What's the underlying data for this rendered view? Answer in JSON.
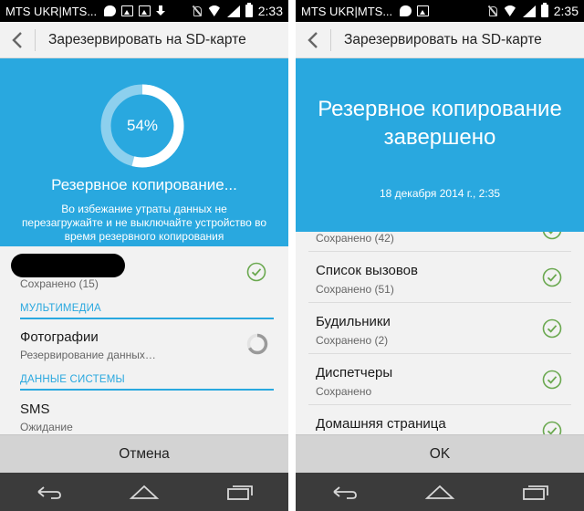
{
  "left": {
    "status_bar": {
      "carrier": "MTS UKR|MTS...",
      "time": "2:33",
      "icons": [
        "hangouts-icon",
        "image-icon",
        "image-icon",
        "download-icon",
        "mute-icon",
        "wifi-icon",
        "signal-icon",
        "battery-icon"
      ]
    },
    "title": "Зарезервировать на SD-карте",
    "progress_value": 0.54,
    "progress_text": "54%",
    "status_text": "Резервное копирование...",
    "warning_text": "Во избежание утраты данных не перезагружайте и не выключайте устройство во время резервного копирования",
    "items": [
      {
        "subtitle": "Сохранено (15)",
        "status": "check-icon"
      }
    ],
    "section_media": "МУЛЬТИМЕДИА",
    "media_items": [
      {
        "title": "Фотографии",
        "subtitle": "Резервирование данных…",
        "status": "spinner-icon"
      }
    ],
    "section_system": "ДАННЫЕ СИСТЕМЫ",
    "system_items": [
      {
        "title": "SMS",
        "subtitle": "Ожидание"
      }
    ],
    "button": "Отмена"
  },
  "right": {
    "status_bar": {
      "carrier": "MTS UKR|MTS...",
      "time": "2:35",
      "icons": [
        "hangouts-icon",
        "image-icon",
        "mute-icon",
        "wifi-icon",
        "signal-icon",
        "battery-icon"
      ]
    },
    "title": "Зарезервировать на SD-карте",
    "done_title": "Резервное копирование завершено",
    "done_date": "18 декабря 2014 г., 2:35",
    "items": [
      {
        "title": "",
        "subtitle": "Сохранено (42)"
      },
      {
        "title": "Список вызовов",
        "subtitle": "Сохранено (51)"
      },
      {
        "title": "Будильники",
        "subtitle": "Сохранено (2)"
      },
      {
        "title": "Диспетчеры",
        "subtitle": "Сохранено"
      },
      {
        "title": "Домашняя страница",
        "subtitle": ""
      }
    ],
    "button": "OK"
  },
  "nav_icons": [
    "back-icon",
    "home-icon",
    "recents-icon"
  ],
  "colors": {
    "accent": "#29a8df",
    "check": "#6aa84f",
    "status_bar": "#000000",
    "nav_bar": "#3b3b3b",
    "button_bar": "#d3d3d3"
  }
}
